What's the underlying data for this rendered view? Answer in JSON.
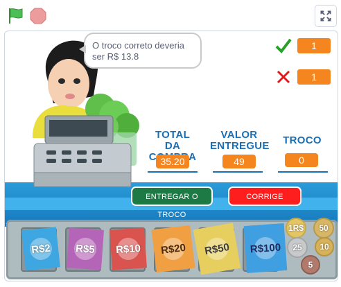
{
  "toolbar": {
    "flag_icon": "green-flag-icon",
    "stop_icon": "stop-icon",
    "fullscreen_icon": "fullscreen-icon"
  },
  "bubble": {
    "text": "O troco correto deveria ser R$ 13.8"
  },
  "score": {
    "correct": "1",
    "wrong": "1"
  },
  "fields": {
    "total_label": "TOTAL DA COMPRA",
    "total_value": "35.20",
    "given_label": "VALOR ENTREGUE",
    "given_value": "49",
    "change_label": "TROCO",
    "change_value": "0"
  },
  "buttons": {
    "deliver": "ENTREGAR O TROCO",
    "fix": "CORRIGE"
  },
  "notes": [
    {
      "label": "R$2",
      "color": "#3ea6e0"
    },
    {
      "label": "R$5",
      "color": "#b565b7"
    },
    {
      "label": "R$10",
      "color": "#d9534f"
    },
    {
      "label": "R$20",
      "color": "#f0a043"
    },
    {
      "label": "R$50",
      "color": "#e6cf5e"
    },
    {
      "label": "R$100",
      "color": "#3f9fe0"
    }
  ],
  "coins": [
    {
      "label": "1R$",
      "color": "#e3c564"
    },
    {
      "label": "50",
      "color": "#d7b766"
    },
    {
      "label": "25",
      "color": "#c7c9cb"
    },
    {
      "label": "10",
      "color": "#d6b25a"
    },
    {
      "label": "5",
      "color": "#b07b6d"
    }
  ]
}
